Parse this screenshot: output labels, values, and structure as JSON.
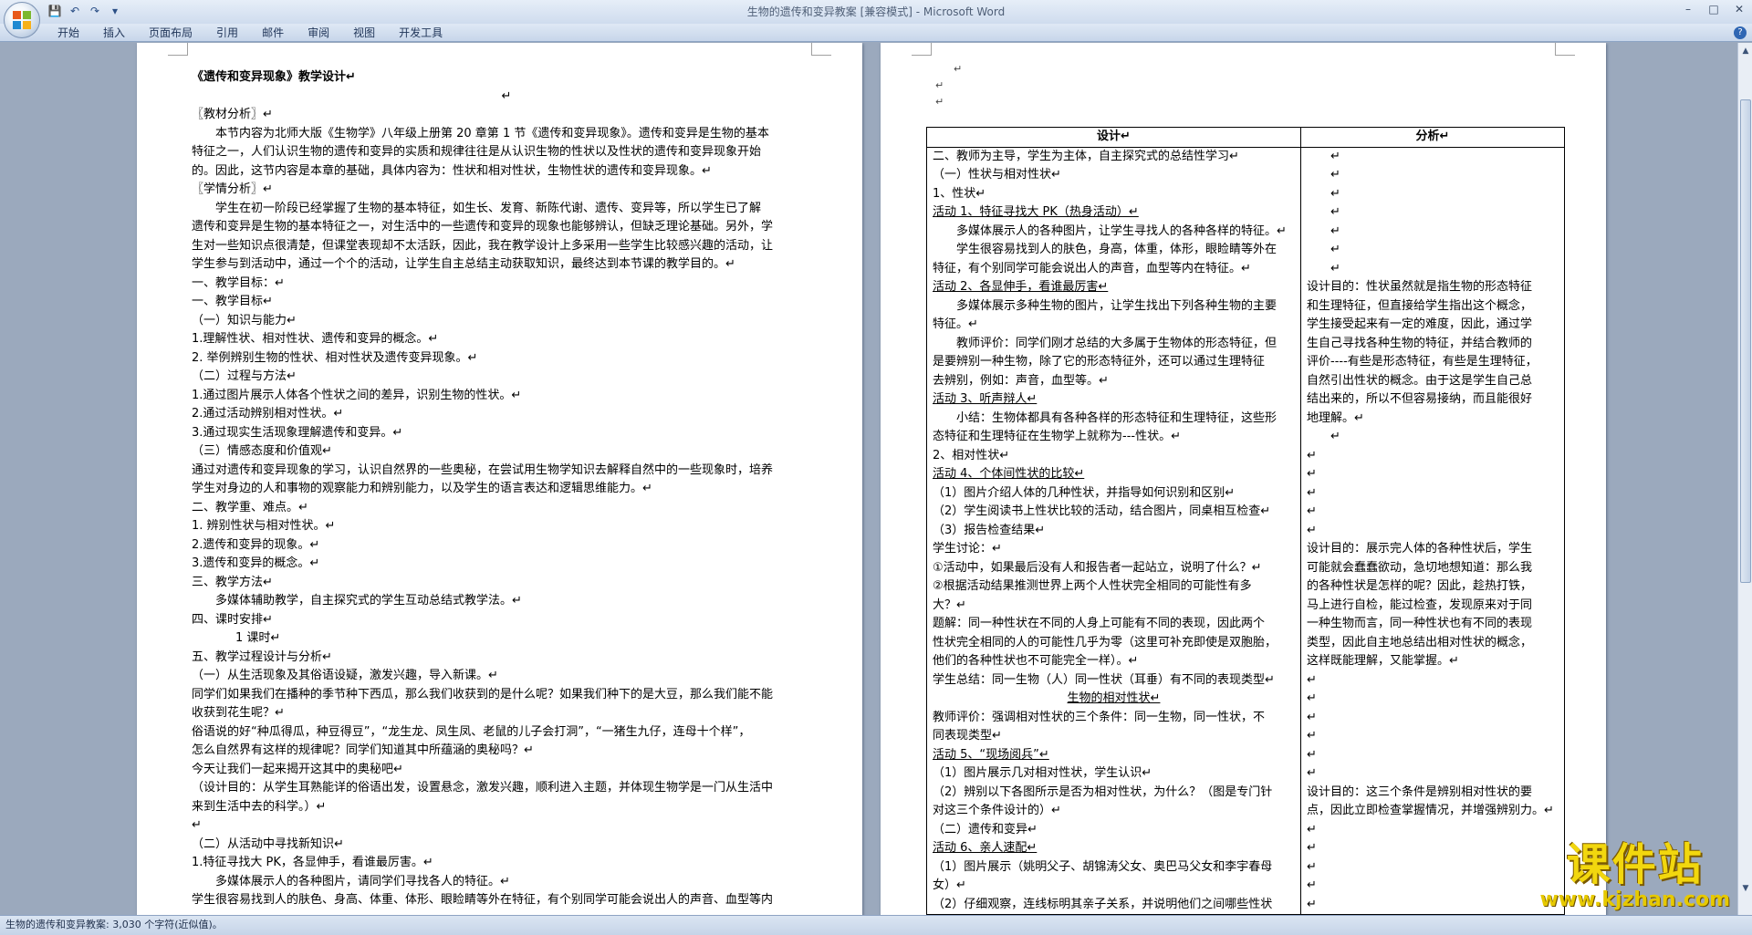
{
  "titlebar": {
    "title": "生物的遗传和变异教案 [兼容模式] - Microsoft Word",
    "qat_icons": [
      "save-icon",
      "undo-icon",
      "redo-icon",
      "customize-icon"
    ],
    "win_buttons": [
      "–",
      "□",
      "✕"
    ]
  },
  "ribbon": {
    "tabs": [
      "开始",
      "插入",
      "页面布局",
      "引用",
      "邮件",
      "审阅",
      "视图",
      "开发工具"
    ],
    "help": "?"
  },
  "left_page": {
    "lines": [
      {
        "t": "《遗传和变异现象》教学设计↵",
        "cls": "title"
      },
      {
        "t": "↵",
        "cls": "center"
      },
      {
        "t": "〖教材分析〗↵",
        "cls": ""
      },
      {
        "t": "本节内容为北师大版《生物学》八年级上册第 20 章第 1 节《遗传和变异现象》。遗传和变异是生物的基本",
        "cls": "ind"
      },
      {
        "t": "特征之一，人们认识生物的遗传和变异的实质和规律往往是从认识生物的性状以及性状的遗传和变异现象开始",
        "cls": ""
      },
      {
        "t": "的。因此，这节内容是本章的基础，具体内容为：性状和相对性状，生物性状的遗传和变异现象。↵",
        "cls": ""
      },
      {
        "t": "〖学情分析〗↵",
        "cls": ""
      },
      {
        "t": "学生在初一阶段已经掌握了生物的基本特征，如生长、发育、新陈代谢、遗传、变异等，所以学生已了解",
        "cls": "ind"
      },
      {
        "t": "遗传和变异是生物的基本特征之一，对生活中的一些遗传和变异的现象也能够辨认，但缺乏理论基础。另外，学",
        "cls": ""
      },
      {
        "t": "生对一些知识点很清楚，但课堂表现却不太活跃，因此，我在教学设计上多采用一些学生比较感兴趣的活动，让",
        "cls": ""
      },
      {
        "t": "学生参与到活动中，通过一个个的活动，让学生自主总结主动获取知识，最终达到本节课的教学目的。↵",
        "cls": ""
      },
      {
        "t": "一、教学目标：↵",
        "cls": ""
      },
      {
        "t": "一、教学目标↵",
        "cls": ""
      },
      {
        "t": "（一）知识与能力↵",
        "cls": ""
      },
      {
        "t": "1.理解性状、相对性状、遗传和变异的概念。↵",
        "cls": ""
      },
      {
        "t": "2. 举例辨别生物的性状、相对性状及遗传变异现象。↵",
        "cls": ""
      },
      {
        "t": "（二）过程与方法↵",
        "cls": ""
      },
      {
        "t": "1.通过图片展示人体各个性状之间的差异，识别生物的性状。↵",
        "cls": ""
      },
      {
        "t": "2.通过活动辨别相对性状。↵",
        "cls": ""
      },
      {
        "t": "3.通过现实生活现象理解遗传和变异。↵",
        "cls": ""
      },
      {
        "t": "（三）情感态度和价值观↵",
        "cls": ""
      },
      {
        "t": "通过对遗传和变异现象的学习，认识自然界的一些奥秘，在尝试用生物学知识去解释自然中的一些现象时，培养",
        "cls": ""
      },
      {
        "t": "学生对身边的人和事物的观察能力和辨别能力，以及学生的语言表达和逻辑思维能力。↵",
        "cls": ""
      },
      {
        "t": "二、教学重、难点。↵",
        "cls": ""
      },
      {
        "t": "1. 辨别性状与相对性状。↵",
        "cls": ""
      },
      {
        "t": "2.遗传和变异的现象。↵",
        "cls": ""
      },
      {
        "t": "3.遗传和变异的概念。↵",
        "cls": ""
      },
      {
        "t": "三、教学方法↵",
        "cls": ""
      },
      {
        "t": "多媒体辅助教学，自主探究式的学生互动总结式教学法。↵",
        "cls": "ind"
      },
      {
        "t": "四、课时安排↵",
        "cls": ""
      },
      {
        "t": "1 课时↵",
        "cls": "ind2"
      },
      {
        "t": "五、教学过程设计与分析↵",
        "cls": ""
      },
      {
        "t": "（一）从生活现象及其俗语设疑，激发兴趣，导入新课。↵",
        "cls": ""
      },
      {
        "t": "同学们如果我们在播种的季节种下西瓜，那么我们收获到的是什么呢？如果我们种下的是大豆，那么我们能不能",
        "cls": ""
      },
      {
        "t": "收获到花生呢？↵",
        "cls": ""
      },
      {
        "t": "俗语说的好“种瓜得瓜，种豆得豆”，“龙生龙、凤生凤、老鼠的儿子会打洞”，“一猪生九仔，连母十个样”，",
        "cls": ""
      },
      {
        "t": "怎么自然界有这样的规律呢？同学们知道其中所蕴涵的奥秘吗？↵",
        "cls": ""
      },
      {
        "t": "今天让我们一起来揭开这其中的奥秘吧↵",
        "cls": ""
      },
      {
        "t": "（设计目的：从学生耳熟能详的俗语出发，设置悬念，激发兴趣，顺利进入主题，并体现生物学是一门从生活中",
        "cls": ""
      },
      {
        "t": "来到生活中去的科学。）↵",
        "cls": ""
      },
      {
        "t": "↵",
        "cls": ""
      },
      {
        "t": "（二）从活动中寻找新知识↵",
        "cls": ""
      },
      {
        "t": "1.特征寻找大 PK，各显伸手，看谁最厉害。↵",
        "cls": ""
      },
      {
        "t": "多媒体展示人的各种图片，请同学们寻找各人的特征。↵",
        "cls": "ind"
      },
      {
        "t": "学生很容易找到人的肤色、身高、体重、体形、眼睑睛等外在特征，有个别同学可能会说出人的声音、血型等内",
        "cls": ""
      }
    ]
  },
  "right_page": {
    "top_marks": [
      "↵",
      "↵",
      "↵"
    ],
    "headers": [
      "设计↵",
      "分析↵"
    ],
    "design_lines": [
      {
        "t": "二、教师为主导，学生为主体，自主探究式的总结性学习↵",
        "cls": ""
      },
      {
        "t": "（一）性状与相对性状↵",
        "cls": ""
      },
      {
        "t": "1、性状↵",
        "cls": ""
      },
      {
        "t": "活动 1、特征寻找大 PK（热身活动）↵",
        "cls": "ul"
      },
      {
        "t": "多媒体展示人的各种图片，让学生寻找人的各种各样的特征。↵",
        "cls": "ind"
      },
      {
        "t": "学生很容易找到人的肤色，身高，体重，体形，眼睑睛等外在",
        "cls": "ind"
      },
      {
        "t": "特征，有个别同学可能会说出人的声音，血型等内在特征。↵",
        "cls": ""
      },
      {
        "t": "活动 2、各显伸手，看谁最厉害↵",
        "cls": "ul"
      },
      {
        "t": "多媒体展示多种生物的图片，让学生找出下列各种生物的主要",
        "cls": "ind"
      },
      {
        "t": "特征。↵",
        "cls": ""
      },
      {
        "t": "教师评价：同学们刚才总结的大多属于生物体的形态特征，但",
        "cls": "ind"
      },
      {
        "t": "是要辨别一种生物，除了它的形态特征外，还可以通过生理特征",
        "cls": ""
      },
      {
        "t": "去辨别，例如：声音，血型等。↵",
        "cls": ""
      },
      {
        "t": "活动 3、听声辩人↵",
        "cls": "ul"
      },
      {
        "t": "小结：生物体都具有各种各样的形态特征和生理特征，这些形",
        "cls": "ind"
      },
      {
        "t": "态特征和生理特征在生物学上就称为---性状。↵",
        "cls": ""
      },
      {
        "t": "2、相对性状↵",
        "cls": ""
      },
      {
        "t": "活动 4、个体间性状的比较↵",
        "cls": "ul"
      },
      {
        "t": "（1）图片介绍人体的几种性状，并指导如何识别和区别↵",
        "cls": ""
      },
      {
        "t": "（2）学生阅读书上性状比较的活动，结合图片，同桌相互检查↵",
        "cls": ""
      },
      {
        "t": "（3）报告检查结果↵",
        "cls": ""
      },
      {
        "t": "学生讨论：↵",
        "cls": ""
      },
      {
        "t": "①活动中，如果最后没有人和报告者一起站立，说明了什么？↵",
        "cls": ""
      },
      {
        "t": "②根据活动结果推测世界上两个人性状完全相同的可能性有多",
        "cls": ""
      },
      {
        "t": "大？↵",
        "cls": ""
      },
      {
        "t": "题解：同一种性状在不同的人身上可能有不同的表现，因此两个",
        "cls": ""
      },
      {
        "t": "性状完全相同的人的可能性几乎为零（这里可补充即使是双胞胎，",
        "cls": ""
      },
      {
        "t": "他们的各种性状也不可能完全一样）。↵",
        "cls": ""
      },
      {
        "t": "学生总结：同一生物（人）同一性状（耳垂）有不同的表现类型↵",
        "cls": ""
      },
      {
        "t": "生物的相对性状↵",
        "cls": "ulc"
      },
      {
        "t": "教师评价：强调相对性状的三个条件：同一生物，同一性状，不",
        "cls": ""
      },
      {
        "t": "同表现类型↵",
        "cls": ""
      },
      {
        "t": "活动 5、“现场阅兵”↵",
        "cls": "ul"
      },
      {
        "t": "（1）图片展示几对相对性状，学生认识↵",
        "cls": ""
      },
      {
        "t": "（2）辨别以下各图所示是否为相对性状，为什么？（图是专门针",
        "cls": ""
      },
      {
        "t": "对这三个条件设计的）↵",
        "cls": ""
      },
      {
        "t": "（二）遗传和变异↵",
        "cls": ""
      },
      {
        "t": "活动 6、亲人速配↵",
        "cls": "ul"
      },
      {
        "t": "（1）图片展示（姚明父子、胡锦涛父女、奥巴马父女和李宇春母",
        "cls": ""
      },
      {
        "t": "女）↵",
        "cls": ""
      },
      {
        "t": "（2）仔细观察，连线标明其亲子关系，并说明他们之间哪些性状",
        "cls": ""
      }
    ],
    "analysis_lines": [
      {
        "t": "↵",
        "cls": "ind"
      },
      {
        "t": "↵",
        "cls": "ind"
      },
      {
        "t": "↵",
        "cls": "ind"
      },
      {
        "t": "↵",
        "cls": "ind"
      },
      {
        "t": "↵",
        "cls": "ind"
      },
      {
        "t": "↵",
        "cls": "ind"
      },
      {
        "t": "↵",
        "cls": "ind"
      },
      {
        "t": "设计目的：性状虽然就是指生物的形态特征",
        "cls": ""
      },
      {
        "t": "和生理特征，但直接给学生指出这个概念，",
        "cls": ""
      },
      {
        "t": "学生接受起来有一定的难度，因此，通过学",
        "cls": ""
      },
      {
        "t": "生自己寻找各种生物的特征，并结合教师的",
        "cls": ""
      },
      {
        "t": "评价----有些是形态特征，有些是生理特征，",
        "cls": ""
      },
      {
        "t": "自然引出性状的概念。由于这是学生自己总",
        "cls": ""
      },
      {
        "t": "结出来的，所以不但容易接纳，而且能很好",
        "cls": ""
      },
      {
        "t": "地理解。↵",
        "cls": ""
      },
      {
        "t": "↵",
        "cls": "ind"
      },
      {
        "t": "↵",
        "cls": ""
      },
      {
        "t": "↵",
        "cls": ""
      },
      {
        "t": "↵",
        "cls": ""
      },
      {
        "t": "↵",
        "cls": ""
      },
      {
        "t": "↵",
        "cls": ""
      },
      {
        "t": "设计目的：展示完人体的各种性状后，学生",
        "cls": ""
      },
      {
        "t": "可能就会蠢蠢欲动，急切地想知道：那么我",
        "cls": ""
      },
      {
        "t": "的各种性状是怎样的呢？因此，趁热打铁，",
        "cls": ""
      },
      {
        "t": "马上进行自检，能过检查，发现原来对于同",
        "cls": ""
      },
      {
        "t": "一种生物而言，同一种性状也有不同的表现",
        "cls": ""
      },
      {
        "t": "类型，因此自主地总结出相对性状的概念，",
        "cls": ""
      },
      {
        "t": "这样既能理解，又能掌握。↵",
        "cls": ""
      },
      {
        "t": "↵",
        "cls": ""
      },
      {
        "t": "↵",
        "cls": ""
      },
      {
        "t": "↵",
        "cls": ""
      },
      {
        "t": "↵",
        "cls": ""
      },
      {
        "t": "↵",
        "cls": ""
      },
      {
        "t": "↵",
        "cls": ""
      },
      {
        "t": "设计目的：这三个条件是辨别相对性状的要",
        "cls": ""
      },
      {
        "t": "点，因此立即检查掌握情况，并增强辨别力。↵",
        "cls": ""
      },
      {
        "t": "↵",
        "cls": ""
      },
      {
        "t": "↵",
        "cls": ""
      },
      {
        "t": "↵",
        "cls": ""
      },
      {
        "t": "↵",
        "cls": ""
      },
      {
        "t": "↵",
        "cls": ""
      }
    ]
  },
  "statusbar": {
    "text": "生物的遗传和变异教案: 3,030 个字符(近似值)。"
  },
  "watermark": {
    "main": "课件站",
    "url": "www.kjzhan.com"
  },
  "colors": {
    "page_bg": "#9ba9bd",
    "ribbon": "#c7d6ea",
    "watermark": "#f2d70e"
  }
}
